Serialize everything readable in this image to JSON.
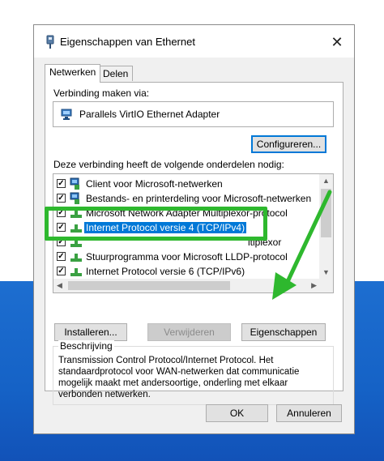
{
  "window": {
    "title": "Eigenschappen van Ethernet",
    "close_glyph": "✕"
  },
  "tabs": [
    {
      "label": "Netwerken",
      "active": true
    },
    {
      "label": "Delen",
      "active": false
    }
  ],
  "connection": {
    "label": "Verbinding maken via:",
    "adapter_name": "Parallels VirtIO Ethernet Adapter",
    "configure_button": "Configureren..."
  },
  "components": {
    "label": "Deze verbinding heeft de volgende onderdelen nodig:",
    "items": [
      {
        "label": "Client voor Microsoft-netwerken",
        "checked": true,
        "icon": "network-client-icon",
        "selected": false
      },
      {
        "label": "Bestands- en printerdeling voor Microsoft-netwerken",
        "checked": true,
        "icon": "file-printer-sharing-icon",
        "selected": false
      },
      {
        "label": "Internet Protocol versie 4 (TCP/IPv4)",
        "checked": true,
        "icon": "protocol-icon",
        "selected": true
      },
      {
        "label": "Microsoft Network Adapter Multiplexor-protocol",
        "checked": false,
        "icon": "protocol-icon",
        "selected": false
      },
      {
        "label": "Stuurprogramma voor Microsoft LLDP-protocol",
        "checked": true,
        "icon": "protocol-icon",
        "selected": false
      },
      {
        "label": "Internet Protocol versie 6 (TCP/IPv6)",
        "checked": true,
        "icon": "protocol-icon",
        "selected": false
      }
    ],
    "partial_visible_tail": "ltiplexor"
  },
  "actions": {
    "install": "Installeren...",
    "remove": "Verwijderen",
    "properties": "Eigenschappen"
  },
  "description": {
    "title": "Beschrijving",
    "text": "Transmission Control Protocol/Internet Protocol. Het standaardprotocol voor WAN-netwerken dat communicatie mogelijk maakt met andersoortige, onderling met elkaar verbonden netwerken."
  },
  "footer": {
    "ok": "OK",
    "cancel": "Annuleren"
  },
  "colors": {
    "highlight_green": "#2eb82e",
    "selection_blue": "#0078d7",
    "desktop_blue": "#1562c6"
  }
}
